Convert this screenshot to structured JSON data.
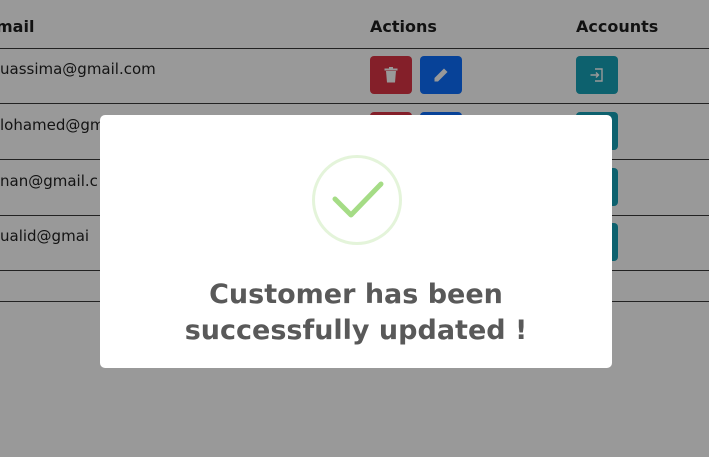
{
  "table": {
    "headers": {
      "email": "mail",
      "actions": "Actions",
      "accounts": "Accounts"
    },
    "rows": [
      {
        "email": "uassima@gmail.com"
      },
      {
        "email": "lohamed@gm"
      },
      {
        "email": "nan@gmail.c"
      },
      {
        "email": "ualid@gmai"
      }
    ],
    "icons": {
      "delete": "trash-icon",
      "edit": "pencil-icon",
      "accounts": "sign-in-icon"
    }
  },
  "modal": {
    "icon": "success-check-icon",
    "title_line1": "Customer has been",
    "title_line2": "successfully updated !"
  },
  "colors": {
    "delete": "#dc3545",
    "edit": "#0d6efd",
    "accounts": "#17a2b8",
    "success": "#a5dc86",
    "overlay": "rgba(0,0,0,0.4)"
  }
}
